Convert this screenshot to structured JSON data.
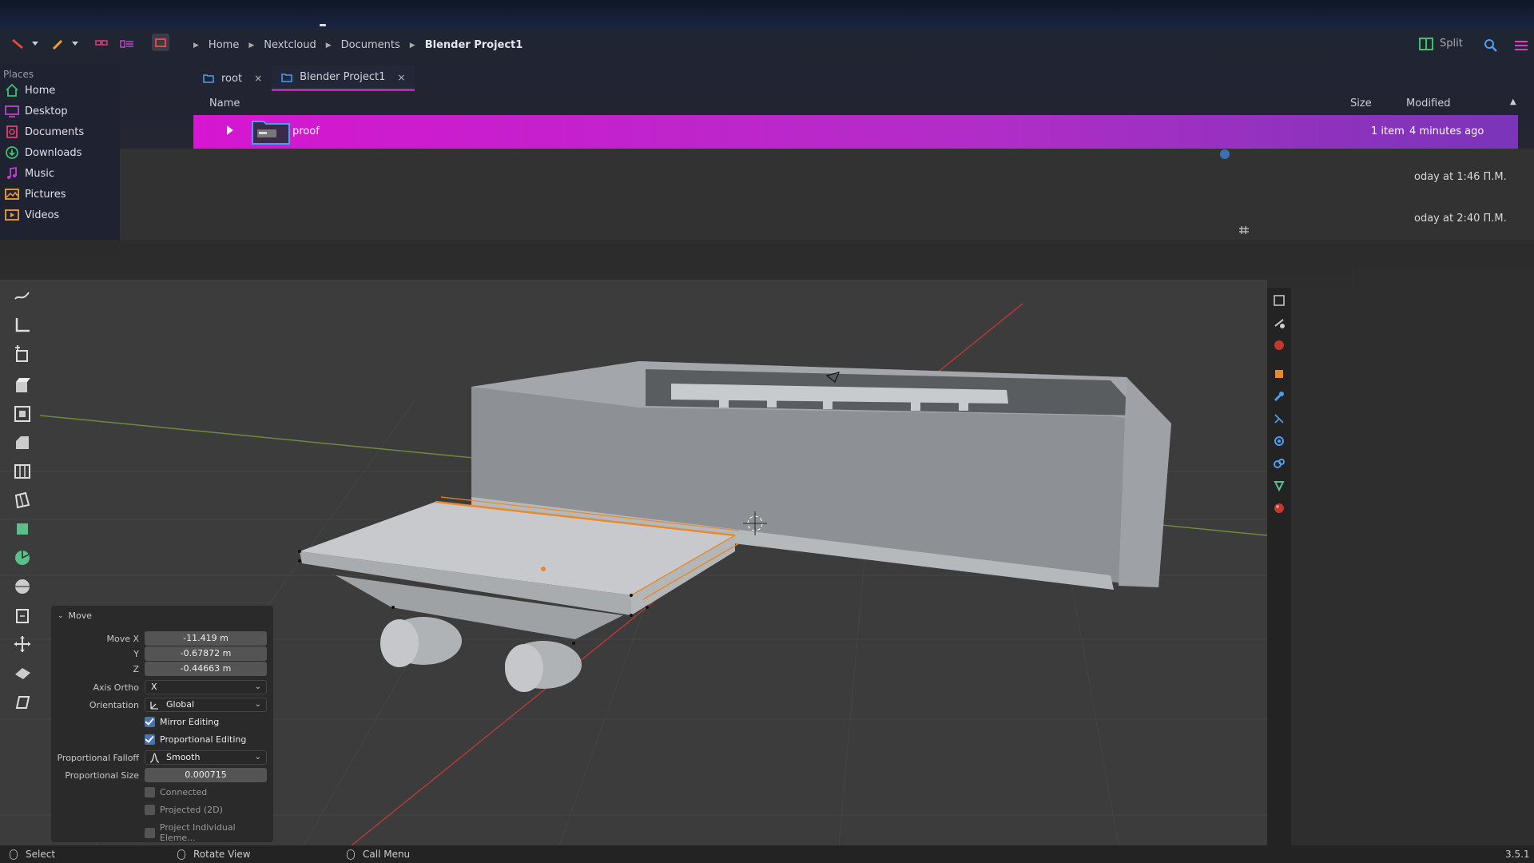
{
  "file_manager": {
    "breadcrumb": [
      "Home",
      "Nextcloud",
      "Documents",
      "Blender Project1"
    ],
    "split_label": "Split",
    "places_title": "Places",
    "places": [
      {
        "label": "Home",
        "icon": "home-icon",
        "color": "#3fbf6f"
      },
      {
        "label": "Desktop",
        "icon": "desktop-icon",
        "color": "#c040d0"
      },
      {
        "label": "Documents",
        "icon": "documents-icon",
        "color": "#e04070"
      },
      {
        "label": "Downloads",
        "icon": "downloads-icon",
        "color": "#3fbf6f"
      },
      {
        "label": "Music",
        "icon": "music-icon",
        "color": "#c040d0"
      },
      {
        "label": "Pictures",
        "icon": "pictures-icon",
        "color": "#f0a030"
      },
      {
        "label": "Videos",
        "icon": "videos-icon",
        "color": "#f0a030"
      }
    ],
    "tabs": [
      {
        "label": "root",
        "close": "×"
      },
      {
        "label": "Blender Project1",
        "close": "×"
      }
    ],
    "columns": {
      "name": "Name",
      "size": "Size",
      "modified": "Modified"
    },
    "rows": [
      {
        "name": "proof",
        "size": "1 item",
        "modified": "4 minutes ago"
      }
    ],
    "ghost_rows": [
      "oday at 1:46 П.М.",
      "oday at 2:40 П.М."
    ],
    "accent": "#d616d0"
  },
  "operator_panel": {
    "title": "Move",
    "move_x_label": "Move X",
    "move_x": "-11.419 m",
    "y_label": "Y",
    "y": "-0.67872 m",
    "z_label": "Z",
    "z": "-0.44663 m",
    "axis_ortho_label": "Axis Ortho",
    "axis_ortho": "X",
    "orientation_label": "Orientation",
    "orientation": "Global",
    "mirror_editing": {
      "label": "Mirror Editing",
      "checked": true
    },
    "proportional_editing": {
      "label": "Proportional Editing",
      "checked": true
    },
    "falloff_label": "Proportional Falloff",
    "falloff": "Smooth",
    "prop_size_label": "Proportional Size",
    "prop_size": "0.000715",
    "connected": {
      "label": "Connected",
      "checked": false
    },
    "projected": {
      "label": "Projected (2D)",
      "checked": false
    },
    "project_individual": {
      "label": "Project Individual Eleme...",
      "checked": false
    }
  },
  "statusbar": {
    "select": "Select",
    "rotate_view": "Rotate View",
    "call_menu": "Call Menu",
    "version": "3.5.1"
  },
  "colors": {
    "viewport_bg": "#3c3c3c",
    "x_axis": "#c83c3c",
    "y_axis": "#7aa040",
    "selection": "#e8892f",
    "checkbox_on": "#4772b3"
  }
}
